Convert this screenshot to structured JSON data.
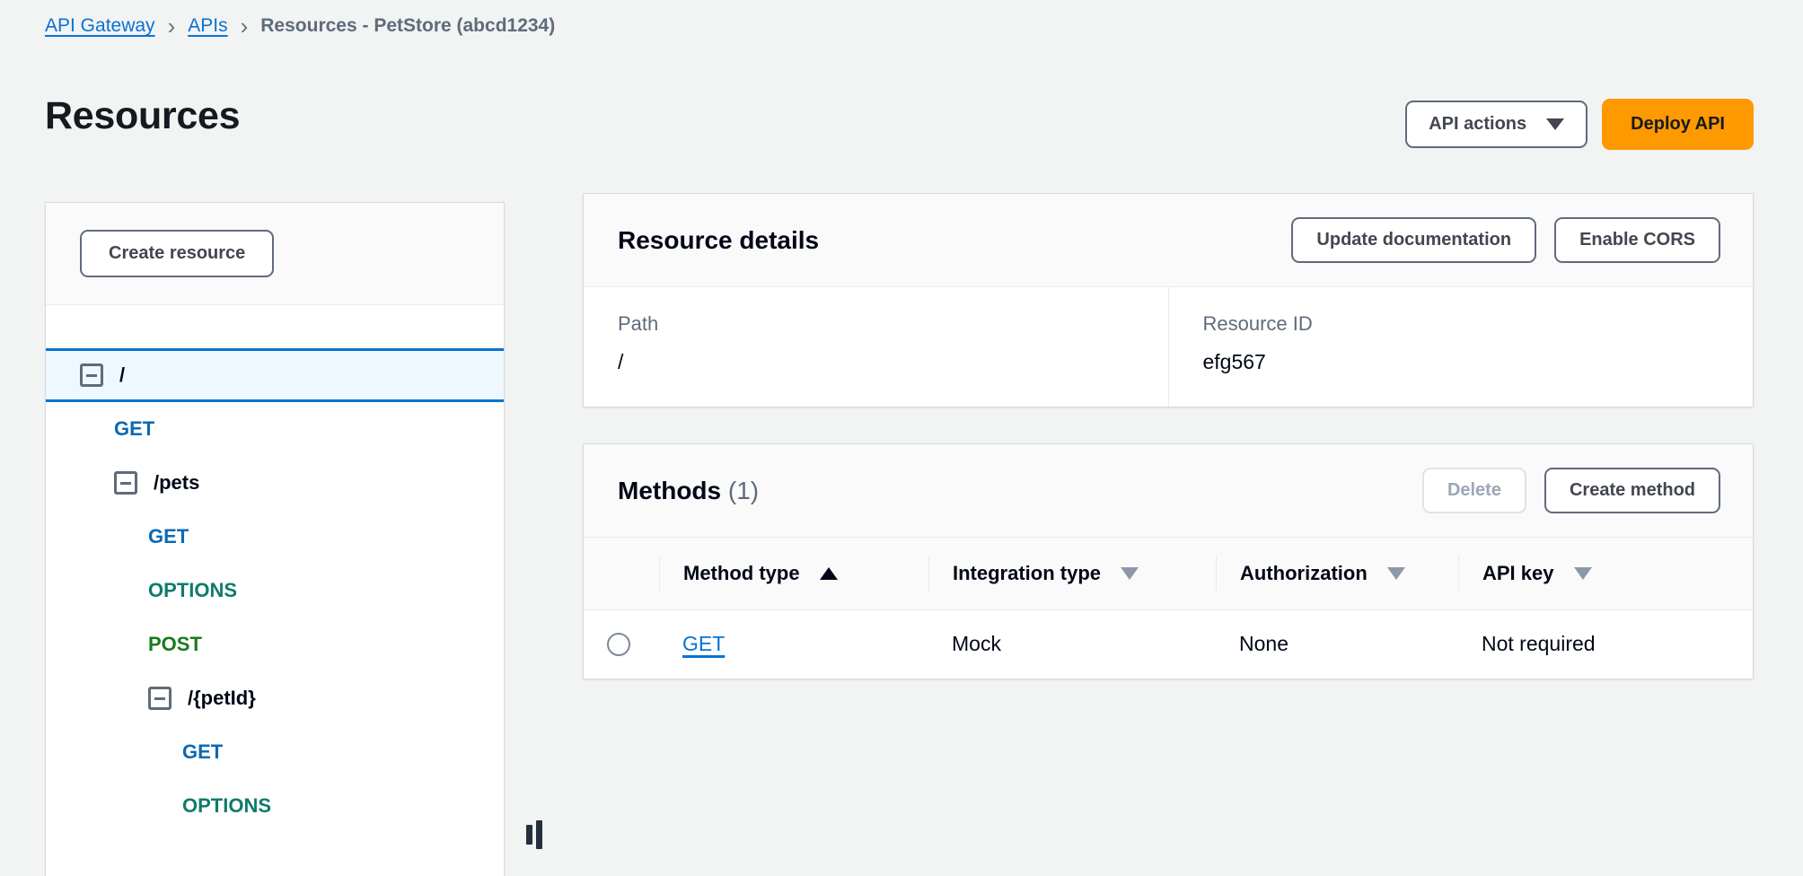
{
  "breadcrumb": {
    "items": [
      {
        "label": "API Gateway",
        "type": "link"
      },
      {
        "label": "APIs",
        "type": "link"
      },
      {
        "label": "Resources - PetStore (abcd1234)",
        "type": "current"
      }
    ],
    "separator": "›"
  },
  "header": {
    "title": "Resources",
    "api_actions_label": "API actions",
    "deploy_label": "Deploy API",
    "accent_orange": "#ff9900",
    "link_blue": "#0972d3"
  },
  "sidebar": {
    "create_resource_label": "Create resource",
    "tree": [
      {
        "label": "/",
        "kind": "resource",
        "indent": 1,
        "expandable": true,
        "selected": true
      },
      {
        "label": "GET",
        "kind": "method",
        "method_color": "get",
        "indent": 2,
        "expandable": false,
        "selected": false
      },
      {
        "label": "/pets",
        "kind": "resource",
        "indent": 2,
        "expandable": true,
        "selected": false
      },
      {
        "label": "GET",
        "kind": "method",
        "method_color": "get",
        "indent": 3,
        "expandable": false,
        "selected": false
      },
      {
        "label": "OPTIONS",
        "kind": "method",
        "method_color": "options",
        "indent": 3,
        "expandable": false,
        "selected": false
      },
      {
        "label": "POST",
        "kind": "method",
        "method_color": "post",
        "indent": 3,
        "expandable": false,
        "selected": false
      },
      {
        "label": "/{petId}",
        "kind": "resource",
        "indent": 3,
        "expandable": true,
        "selected": false
      },
      {
        "label": "GET",
        "kind": "method",
        "method_color": "get",
        "indent": 4,
        "expandable": false,
        "selected": false
      },
      {
        "label": "OPTIONS",
        "kind": "method",
        "method_color": "options",
        "indent": 4,
        "expandable": false,
        "selected": false
      }
    ],
    "method_colors": {
      "get": "#0b69b3",
      "options": "#0f7b6c",
      "post": "#1a7a1a"
    }
  },
  "resource_details": {
    "title": "Resource details",
    "update_documentation_label": "Update documentation",
    "enable_cors_label": "Enable CORS",
    "path_label": "Path",
    "path_value": "/",
    "resource_id_label": "Resource ID",
    "resource_id_value": "efg567"
  },
  "methods": {
    "title": "Methods",
    "count": "(1)",
    "delete_label": "Delete",
    "delete_disabled": true,
    "create_method_label": "Create method",
    "columns": [
      {
        "label": "Method type",
        "sort": "asc"
      },
      {
        "label": "Integration type",
        "sort": "none"
      },
      {
        "label": "Authorization",
        "sort": "none"
      },
      {
        "label": "API key",
        "sort": "none"
      }
    ],
    "rows": [
      {
        "selected": false,
        "method_type": "GET",
        "integration_type": "Mock",
        "authorization": "None",
        "api_key": "Not required"
      }
    ]
  }
}
